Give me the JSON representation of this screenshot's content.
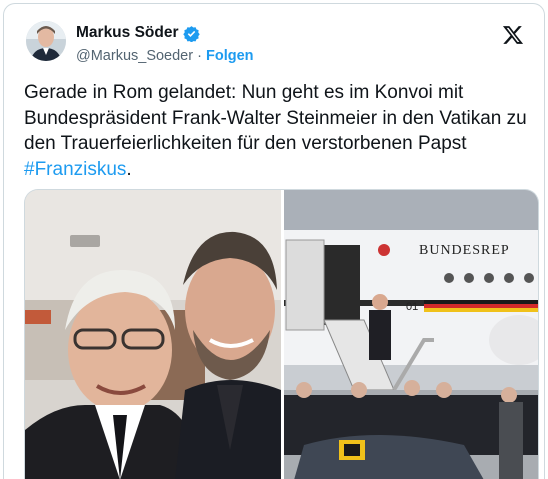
{
  "author": {
    "name": "Markus Söder",
    "handle": "@Markus_Soeder",
    "separator": "·",
    "follow_label": "Folgen"
  },
  "tweet": {
    "text": "Gerade in Rom gelandet: Nun geht es im Konvoi mit Bundespräsident Frank-Walter Steinmeier in den Vatikan zu den Trauerfeierlichkeiten für den verstorbenen Papst ",
    "hashtag": "#Franziskus",
    "trailing": "."
  },
  "photos": {
    "right_plane_lettering": "BUNDESREP",
    "right_plane_number": "01"
  },
  "icons": {
    "verified": "verified-badge-icon",
    "logo": "x-logo-icon"
  },
  "colors": {
    "accent": "#1d9bf0",
    "text": "#0f1419",
    "muted": "#536471"
  }
}
